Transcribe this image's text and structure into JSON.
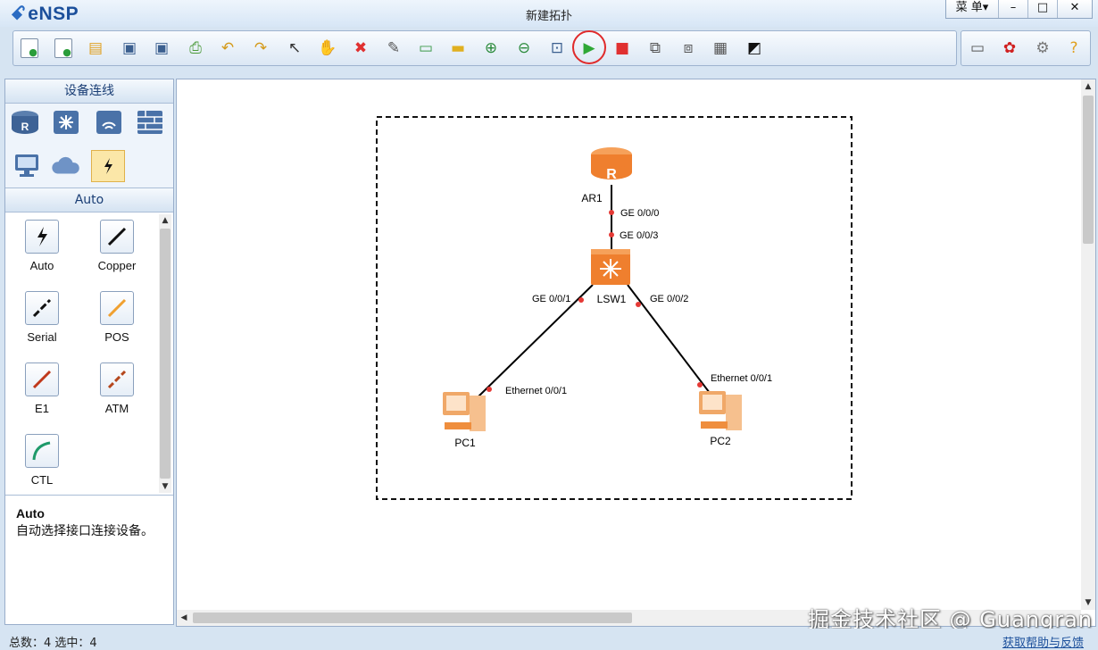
{
  "app": {
    "name": "eNSP",
    "window_title": "新建拓扑",
    "menu_label": "菜 单▾"
  },
  "window_controls": {
    "minimize": "–",
    "maximize": "□",
    "close": "✕"
  },
  "toolbar": {
    "icons": [
      "new-topology-icon",
      "new-template-icon",
      "open-icon",
      "save-icon",
      "save-as-icon",
      "print-icon",
      "undo-icon",
      "redo-icon",
      "select-pointer-icon",
      "pan-hand-icon",
      "delete-icon",
      "delete-link-icon",
      "text-annotation-icon",
      "rectangle-icon",
      "zoom-in-icon",
      "zoom-out-icon",
      "fit-view-icon",
      "start-device-icon",
      "stop-device-icon",
      "capture-icon",
      "topology-arrange-icon",
      "grid-icon",
      "screenshot-icon"
    ],
    "right_icons": [
      "message-icon",
      "huawei-logo-icon",
      "settings-gear-icon",
      "help-icon"
    ]
  },
  "left_panel": {
    "title": "设备连线",
    "device_icons": [
      "router-icon",
      "switch-icon",
      "wlan-icon",
      "firewall-icon",
      "pc-icon",
      "cloud-icon",
      "cable-icon"
    ],
    "subtitle": "Auto",
    "cables": [
      {
        "label": "Auto"
      },
      {
        "label": "Copper"
      },
      {
        "label": "Serial"
      },
      {
        "label": "POS"
      },
      {
        "label": "E1"
      },
      {
        "label": "ATM"
      },
      {
        "label": "CTL"
      }
    ],
    "description": {
      "title": "Auto",
      "text": "自动选择接口连接设备。"
    }
  },
  "topology": {
    "nodes": [
      {
        "name": "AR1",
        "kind": "router"
      },
      {
        "name": "LSW1",
        "kind": "switch"
      },
      {
        "name": "PC1",
        "kind": "pc"
      },
      {
        "name": "PC2",
        "kind": "pc"
      }
    ],
    "links": [
      {
        "a_port": "GE 0/0/0",
        "b_port": "GE 0/0/3"
      },
      {
        "a_port": "GE 0/0/1",
        "b_port": "Ethernet 0/0/1"
      },
      {
        "a_port": "GE 0/0/2",
        "b_port": "Ethernet 0/0/1"
      }
    ]
  },
  "status": {
    "total": "总数：4 选中：4",
    "help_link": "获取帮助与反馈"
  },
  "watermark": "掘金技术社区 @ Guangran",
  "colors": {
    "router": "#f07d2b",
    "switch": "#f07d2b",
    "link": "#000000",
    "port_dot": "#e53935",
    "start_highlight": "#e02b2b"
  }
}
